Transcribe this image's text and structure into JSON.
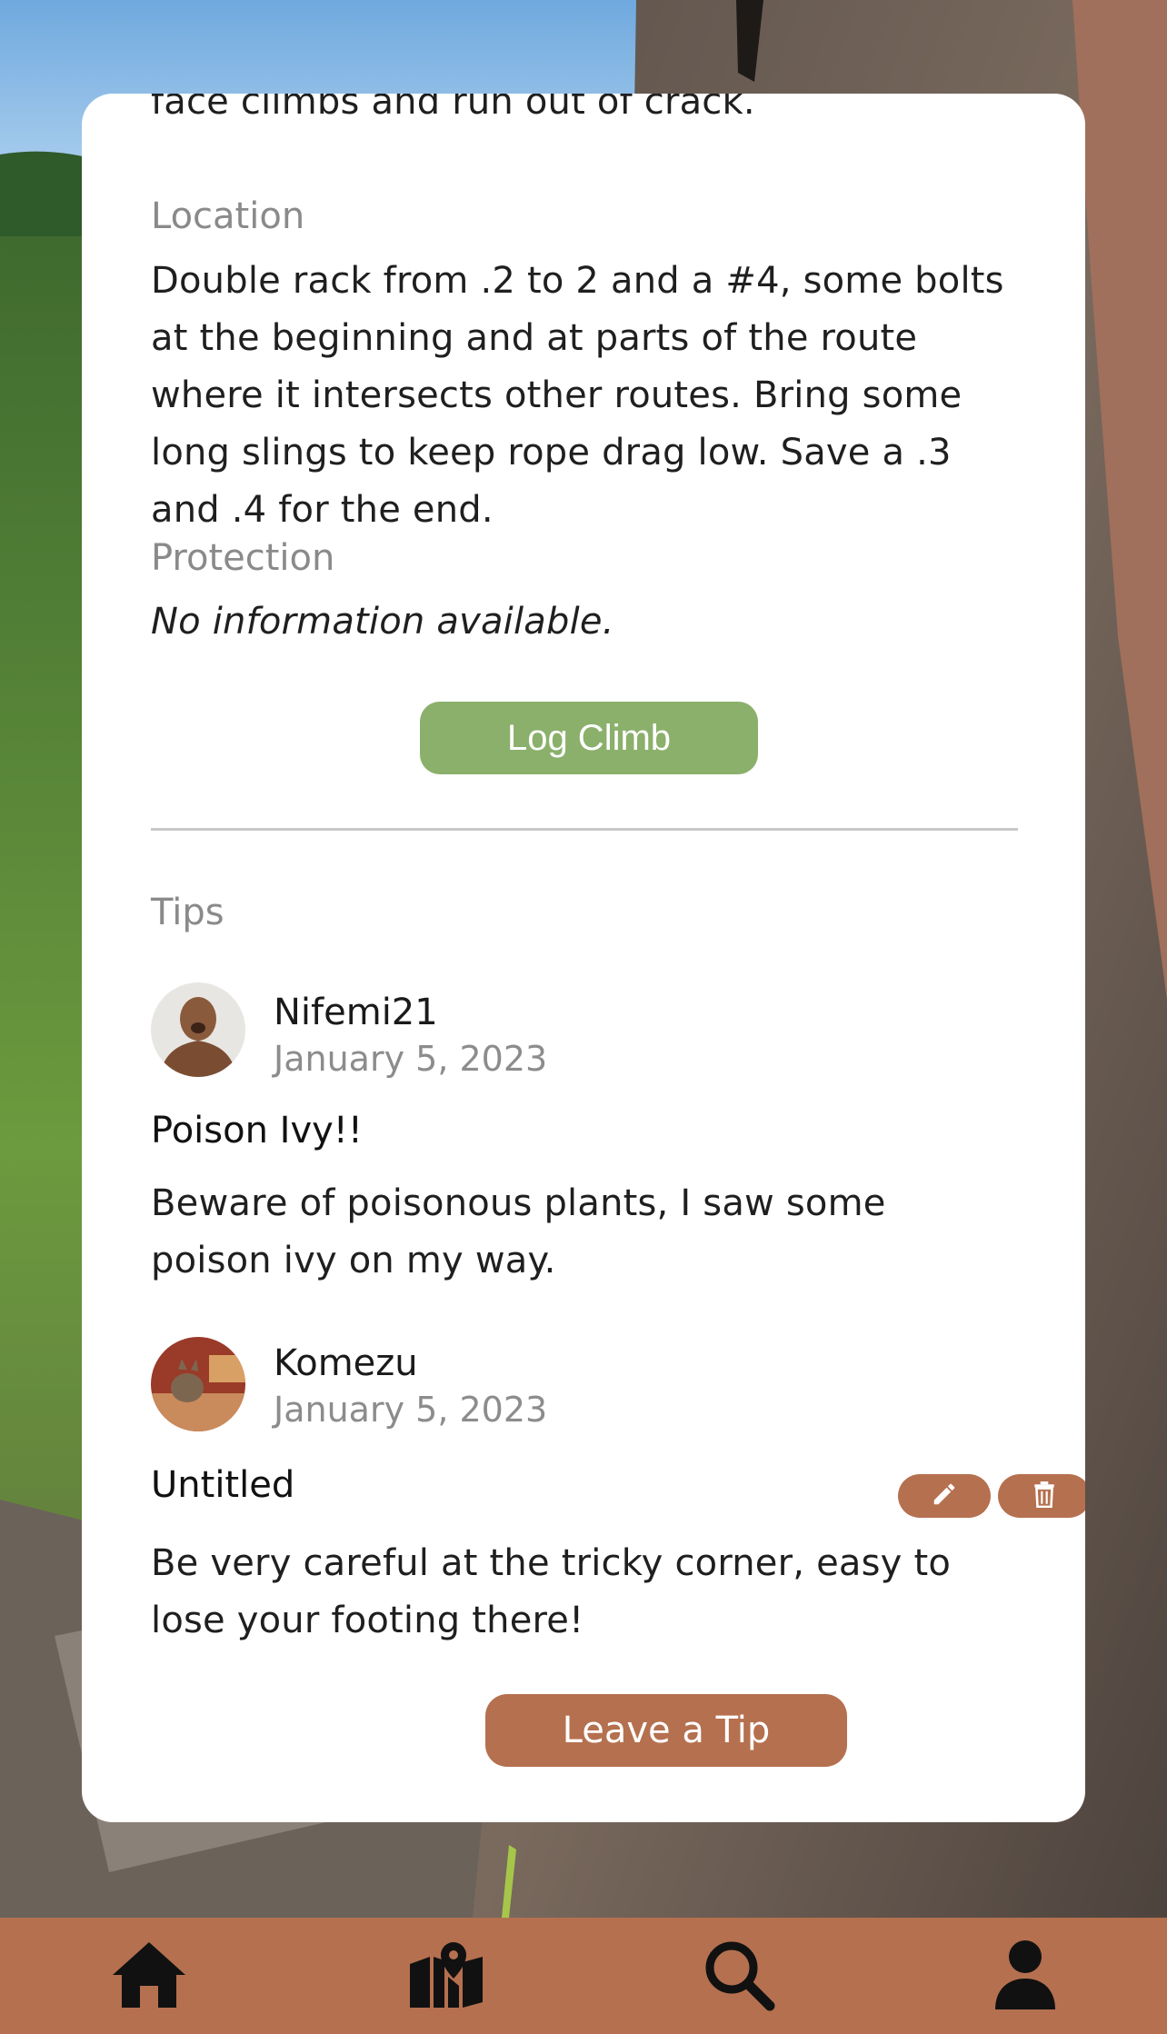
{
  "route": {
    "description_tail": "face climbs and run out of crack.",
    "location_label": "Location",
    "location_text": "Double rack from .2 to 2 and a #4, some bolts at the beginning and at parts of the route where it intersects other routes. Bring some long slings to keep rope drag low. Save a .3 and .4 for the end.",
    "protection_label": "Protection",
    "protection_text": "No information available.",
    "log_button": "Log Climb"
  },
  "tips": {
    "label": "Tips",
    "items": [
      {
        "author": "Nifemi21",
        "date": "January 5, 2023",
        "title": "Poison Ivy!!",
        "body": "Beware of poisonous plants, I saw some poison ivy on my way."
      },
      {
        "author": "Komezu",
        "date": "January 5, 2023",
        "title": "Untitled",
        "body": "Be very careful at the tricky corner, easy to lose your footing there!"
      }
    ],
    "edit_icon": "pencil-icon",
    "delete_icon": "trash-icon",
    "leave_button": "Leave a Tip"
  },
  "nav": {
    "items": [
      "home-icon",
      "map-icon",
      "search-icon",
      "profile-icon"
    ]
  },
  "colors": {
    "accent": "#b5704f",
    "log_green": "#8bb06b",
    "label_gray": "#8a8a8a"
  }
}
